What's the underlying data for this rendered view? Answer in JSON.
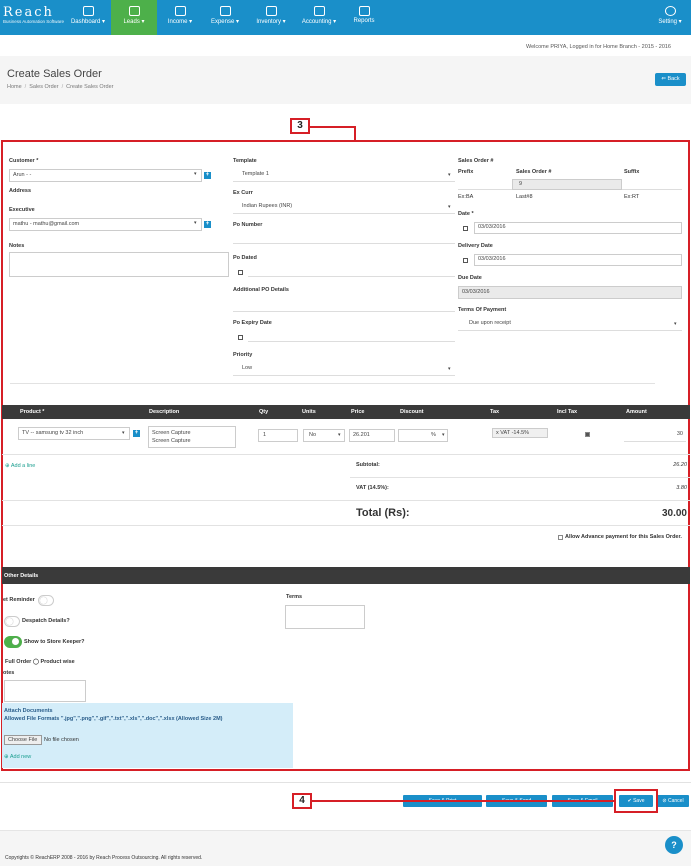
{
  "brand": {
    "name": "Reach",
    "tagline": "Business Automation Software"
  },
  "nav": {
    "items": [
      {
        "label": "Dashboard",
        "caret": "▾"
      },
      {
        "label": "Leads",
        "caret": "▾"
      },
      {
        "label": "Income",
        "caret": "▾"
      },
      {
        "label": "Expense",
        "caret": "▾"
      },
      {
        "label": "Inventory",
        "caret": "▾"
      },
      {
        "label": "Accounting",
        "caret": "▾"
      },
      {
        "label": "Reports",
        "caret": ""
      },
      {
        "label": "Setting",
        "caret": "▾"
      }
    ]
  },
  "welcome": "Welcome PRIYA, Logged in for Home Branch - 2015 - 2016",
  "page": {
    "title": "Create Sales Order",
    "back": "Back",
    "breadcrumb": [
      "Home",
      "Sales Order",
      "Create Sales Order"
    ]
  },
  "callouts": {
    "one": "3",
    "two": "4"
  },
  "form": {
    "customer": {
      "label": "Customer *",
      "value": "Arun - -"
    },
    "address": {
      "label": "Address"
    },
    "executive": {
      "label": "Executive",
      "value": "mathu - mathu@gmail.com"
    },
    "notes": {
      "label": "Notes"
    },
    "template": {
      "label": "Template",
      "value": "Template 1"
    },
    "excurr": {
      "label": "Ex Curr",
      "value": "Indian Rupees (INR)"
    },
    "ponumber": {
      "label": "Po Number"
    },
    "podated": {
      "label": "Po Dated"
    },
    "addpo": {
      "label": "Additional PO Details"
    },
    "poexpiry": {
      "label": "Po Expiry Date"
    },
    "priority": {
      "label": "Priority",
      "value": "Low"
    },
    "so": {
      "label": "Sales Order #",
      "prefix_label": "Prefix",
      "number_label": "Sales Order #",
      "suffix_label": "Suffix",
      "number_value": "9",
      "ex_prefix": "Ex:BA",
      "last": "Last#8",
      "ex_suffix": "Ex:RT"
    },
    "date": {
      "label": "Date *",
      "value": "03/03/2016"
    },
    "delivery": {
      "label": "Delivery Date",
      "value": "03/03/2016"
    },
    "due": {
      "label": "Due Date",
      "value": "03/03/2016"
    },
    "terms": {
      "label": "Terms Of Payment",
      "value": "Due upon receipt"
    }
  },
  "table": {
    "headers": [
      "Product *",
      "Description",
      "Qty",
      "Units",
      "Price",
      "Discount",
      "Tax",
      "Incl Tax",
      "Amount"
    ],
    "row": {
      "product": "TV -- samsung tv 32 inch",
      "desc1": "Screen Capture",
      "desc2": "Screen Capture",
      "qty": "1",
      "units": "No",
      "price": "26.201",
      "discount_unit": "%",
      "tax": "x VAT -14.5%",
      "amount": "30"
    },
    "add_line": "Add a line",
    "subtotal_label": "Subtotal:",
    "subtotal": "26.20",
    "vat_label": "VAT (14.5%):",
    "vat": "3.80",
    "total_label": "Total (Rs):",
    "total": "30.00",
    "advance": "Allow Advance payment for this Sales Order."
  },
  "other": {
    "title": "Other Details",
    "reminder": "et Reminder",
    "despatch": "Despatch Details?",
    "store": "Show to Store Keeper?",
    "full": "Full Order",
    "product_wise": "Product wise",
    "notes": "otes",
    "terms": "Terms"
  },
  "attach": {
    "title": "Attach Documents",
    "formats": "Allowed File Formats \".jpg\",\".png\",\".gif\",\".txt\",\".xls\",\".doc\",\".xlsx (Allowed Size 2M)",
    "choose": "Choose File",
    "nofile": "No file chosen",
    "add_new": "Add new"
  },
  "footer_buttons": {
    "b1": "Save & Print",
    "b2": "Save & Send",
    "b3": "Save & Email",
    "save": "Save",
    "cancel": "Cancel"
  },
  "copyright": "Copyrights © ReachERP 2008 - 2016 by Reach Process Outsourcing. All rights reserved."
}
